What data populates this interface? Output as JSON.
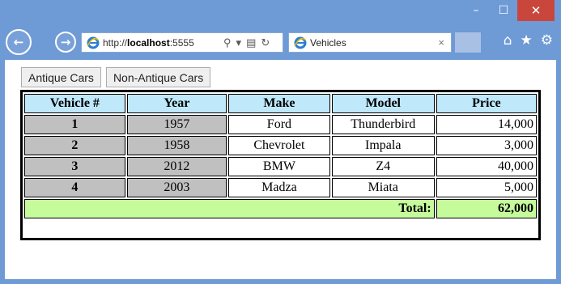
{
  "browser": {
    "url_prefix": "http://",
    "url_host": "localhost",
    "url_rest": ":5555",
    "tab_title": "Vehicles",
    "tab_close": "×"
  },
  "buttons": {
    "antique": "Antique Cars",
    "non_antique": "Non-Antique Cars"
  },
  "table": {
    "headers": [
      "Vehicle #",
      "Year",
      "Make",
      "Model",
      "Price"
    ],
    "rows": [
      [
        "1",
        "1957",
        "Ford",
        "Thunderbird",
        "14,000"
      ],
      [
        "2",
        "1958",
        "Chevrolet",
        "Impala",
        "3,000"
      ],
      [
        "3",
        "2012",
        "BMW",
        "Z4",
        "40,000"
      ],
      [
        "4",
        "2003",
        "Madza",
        "Miata",
        "5,000"
      ]
    ],
    "total_label": "Total:",
    "total_value": "62,000"
  },
  "colors": {
    "header_bg": "#bfe8fa",
    "gray_cell": "#c0c0c0",
    "total_bg": "#c6fb9c",
    "window_frame": "#6e9ad6"
  },
  "icons": [
    "minimize-icon",
    "maximize-icon",
    "close-icon",
    "back-icon",
    "forward-icon",
    "ie-icon",
    "search-icon",
    "dropdown-icon",
    "compat-icon",
    "refresh-icon",
    "home-icon",
    "favorites-icon",
    "settings-icon"
  ]
}
